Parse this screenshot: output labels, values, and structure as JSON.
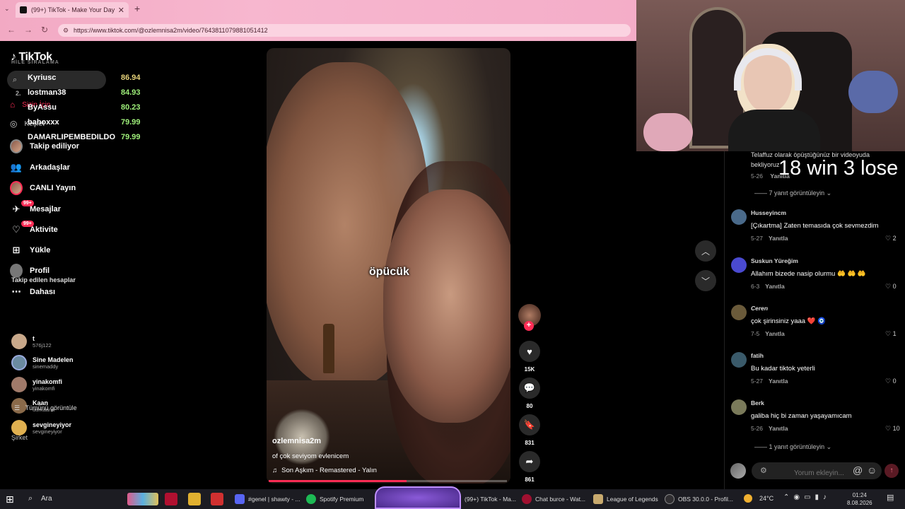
{
  "browser": {
    "tab_title": "(99+) TikTok - Make Your Day",
    "tab_close": "✕",
    "new_tab": "+",
    "url": "https://www.tiktok.com/@ozlemnisa2m/video/7643811079881051412"
  },
  "tiktok": {
    "logo": "TikTok",
    "overlay_title": "HİLE SIRALAMA",
    "for_you": "Sizin İçin",
    "explore": "Keşfet",
    "nav": [
      {
        "label": "Takip ediliyor"
      },
      {
        "label": "Arkadaşlar"
      },
      {
        "label": "CANLI Yayın"
      },
      {
        "label": "Mesajlar",
        "badge": "99+"
      },
      {
        "label": "Aktivite",
        "badge": "99+"
      },
      {
        "label": "Yükle"
      },
      {
        "label": "Profil"
      },
      {
        "label": "Dahası"
      }
    ],
    "followed_title": "Takip edilen hesaplar",
    "followed": [
      {
        "name": "t",
        "user": "576j122"
      },
      {
        "name": "Sine Madelen",
        "user": "sinemaddy"
      },
      {
        "name": "yinakomfi",
        "user": "yinakomfi"
      },
      {
        "name": "Kaan",
        "user": "uurkaann"
      },
      {
        "name": "sevgineyiyor",
        "user": "sevgineyiyor"
      }
    ],
    "see_all": "Tümünü görüntüle",
    "company": "Şirket"
  },
  "leaderboard": [
    {
      "rank": "",
      "name": "Kyriusc",
      "score": "86.94"
    },
    {
      "rank": "2.",
      "name": "lostman38",
      "score": "84.93"
    },
    {
      "rank": "",
      "name": "ByAssu",
      "score": "80.23"
    },
    {
      "rank": "",
      "name": "bahoxxx",
      "score": "79.99"
    },
    {
      "rank": "",
      "name": "DAMARLIPEMBEDILDO",
      "score": "79.99"
    }
  ],
  "video": {
    "overlay_text": "öpücük",
    "author": "ozlemnisa2m",
    "description": "of çok seviyom evlenicem",
    "music": "Son Aşkım - Remastered - Yalın",
    "progress": 0.58,
    "likes": "15K",
    "comments": "80",
    "saves": "831",
    "shares": "861"
  },
  "comments": {
    "top_text_1": "Telaffuz olarak öpüştüğünüz bir videoyuda",
    "top_text_2": "bekliyoruz",
    "top_meta_date": "5-26",
    "top_meta_reply": "Yanıtla",
    "top_more": "7 yanıt görüntüleyin",
    "win_lose": "18 win 3 lose",
    "items": [
      {
        "user": "Husseyincm",
        "text": "[Çıkartma] Zaten temasıda çok sevmezdim",
        "date": "5-27",
        "reply": "Yanıtla",
        "likes": "2"
      },
      {
        "user": "Suskun Yüreğim",
        "text": "Allahım bizede nasip olurmu 🤲 🤲 🤲",
        "date": "6-3",
        "reply": "Yanıtla",
        "likes": "0"
      },
      {
        "user": "Ceren",
        "text": "çok şirinsiniz yaaa ❤️ 🧿",
        "date": "7-5",
        "reply": "Yanıtla",
        "likes": "1"
      },
      {
        "user": "fatih",
        "text": "Bu kadar tiktok yeterli",
        "date": "5-27",
        "reply": "Yanıtla",
        "likes": "0"
      },
      {
        "user": "Berk",
        "text": "galiba hiç bi zaman yaşayamıcam",
        "date": "5-26",
        "reply": "Yanıtla",
        "likes": "10"
      }
    ],
    "bottom_more": "1 yanıt görüntüleyin",
    "input_placeholder": "Yorum ekleyin..."
  },
  "taskbar": {
    "search": "Ara",
    "apps": [
      {
        "label": "#genel | shawty - ...",
        "color": "#5865f2"
      },
      {
        "label": "Spotify Premium",
        "color": "#1db954"
      },
      {
        "label": "(99+) TikTok - Ma...",
        "color": "#111111"
      },
      {
        "label": "Chat burce - Wat...",
        "color": "#a01030"
      },
      {
        "label": "League of Legends",
        "color": "#c8aa6e"
      },
      {
        "label": "OBS 30.0.0 - Profil...",
        "color": "#302e31"
      }
    ],
    "weather": "24°C",
    "time": "01:24",
    "date": "8.08.2026"
  }
}
